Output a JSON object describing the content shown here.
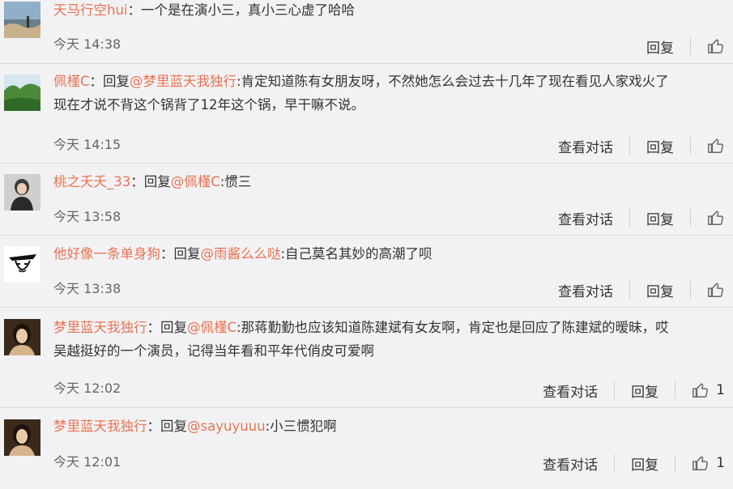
{
  "comments": [
    {
      "user": "天马行空hui",
      "sep": "：",
      "reply_prefix": "",
      "at": "",
      "body": "一个是在演小三，真小三心虚了哈哈",
      "body2": "",
      "time": "今天 14:38",
      "view_conv": "",
      "reply": "回复",
      "likes": ""
    },
    {
      "user": "佩槿C",
      "sep": "：",
      "reply_prefix": "回复",
      "at": "@梦里蓝天我独行",
      "body": ":肯定知道陈有女朋友呀，不然她怎么会过去十几年了现在看见人家戏火了",
      "body2": "现在才说不背这个锅背了12年这个锅，早干嘛不说。",
      "time": "今天 14:15",
      "view_conv": "查看对话",
      "reply": "回复",
      "likes": ""
    },
    {
      "user": "桃之夭夭_33",
      "sep": "：",
      "reply_prefix": "回复",
      "at": "@佩槿C",
      "body": ":惯三",
      "body2": "",
      "time": "今天 13:58",
      "view_conv": "查看对话",
      "reply": "回复",
      "likes": ""
    },
    {
      "user": "他好像一条单身狗",
      "sep": "：",
      "reply_prefix": "回复",
      "at": "@雨酱么么哒",
      "body": ":自己莫名其妙的高潮了呗",
      "body2": "",
      "time": "今天 13:38",
      "view_conv": "查看对话",
      "reply": "回复",
      "likes": ""
    },
    {
      "user": "梦里蓝天我独行",
      "sep": "：",
      "reply_prefix": "回复",
      "at": "@佩槿C",
      "body": ":那蒋勤勤也应该知道陈建斌有女友啊，肯定也是回应了陈建斌的暧昧，哎",
      "body2": "吴越挺好的一个演员，记得当年看和平年代俏皮可爱啊",
      "time": "今天 12:02",
      "view_conv": "查看对话",
      "reply": "回复",
      "likes": "1"
    },
    {
      "user": "梦里蓝天我独行",
      "sep": "：",
      "reply_prefix": "回复",
      "at": "@sayuyuuu",
      "body": ":小三惯犯啊",
      "body2": "",
      "time": "今天 12:01",
      "view_conv": "查看对话",
      "reply": "回复",
      "likes": "1"
    }
  ],
  "colors": {
    "link": "#eb7350",
    "background": "#f2f2f5"
  }
}
